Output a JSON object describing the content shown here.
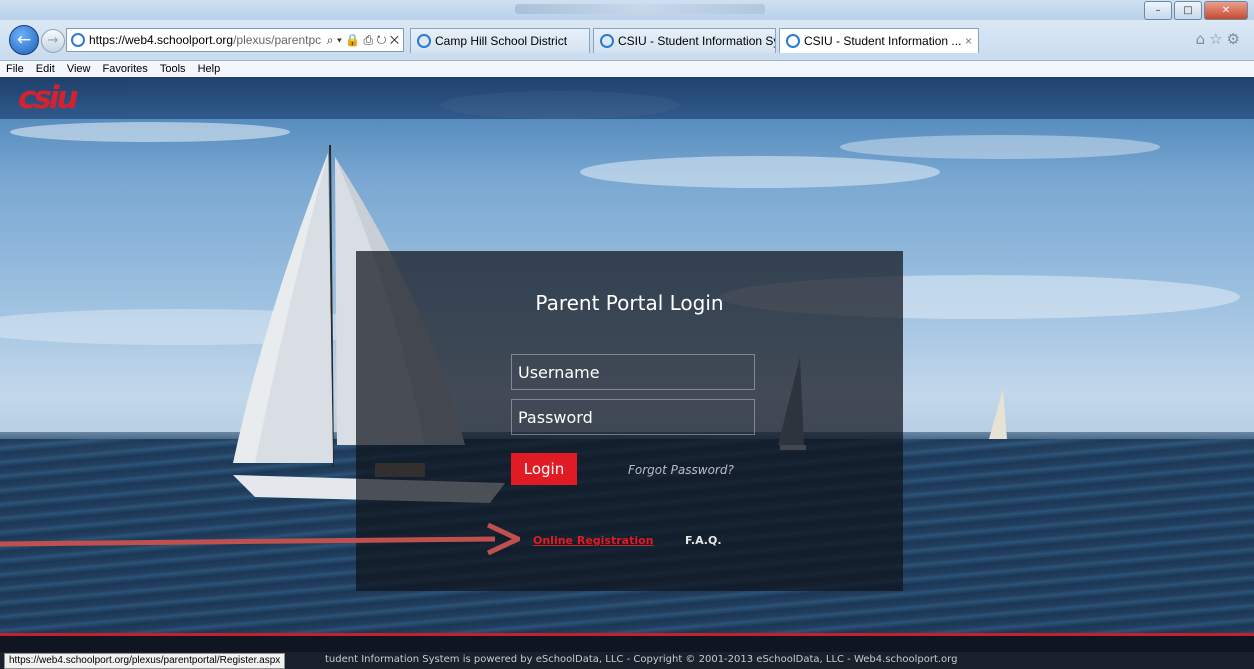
{
  "browser": {
    "address_domain": "https://web4.schoolport.org",
    "address_path": "/plexus/parentpc",
    "address_tools": "⌕ ▾ 🔒 ⎙ ↻ ✕",
    "tabs": [
      {
        "label": "Camp Hill School District"
      },
      {
        "label": "CSIU - Student Information Sys..."
      },
      {
        "label": "CSIU - Student Information ...",
        "close": "×"
      }
    ],
    "right_icons": "⌂☆⚙"
  },
  "menu": [
    "File",
    "Edit",
    "View",
    "Favorites",
    "Tools",
    "Help"
  ],
  "header": {
    "logo": "csiu"
  },
  "login": {
    "title": "Parent Portal Login",
    "username_placeholder": "Username",
    "password_placeholder": "Password",
    "login_label": "Login",
    "forgot_label": "Forgot Password?",
    "register_label": "Online Registration",
    "faq_label": "F.A.Q."
  },
  "status": {
    "url": "https://web4.schoolport.org/plexus/parentportal/Register.aspx",
    "footer_text": "tudent Information System is powered by eSchoolData, LLC - Copyright © 2001-2013 eSchoolData, LLC - Web4.schoolport.org"
  },
  "colors": {
    "accent": "#e01b24",
    "card": "#0f141c",
    "arrow": "#c0504d"
  }
}
